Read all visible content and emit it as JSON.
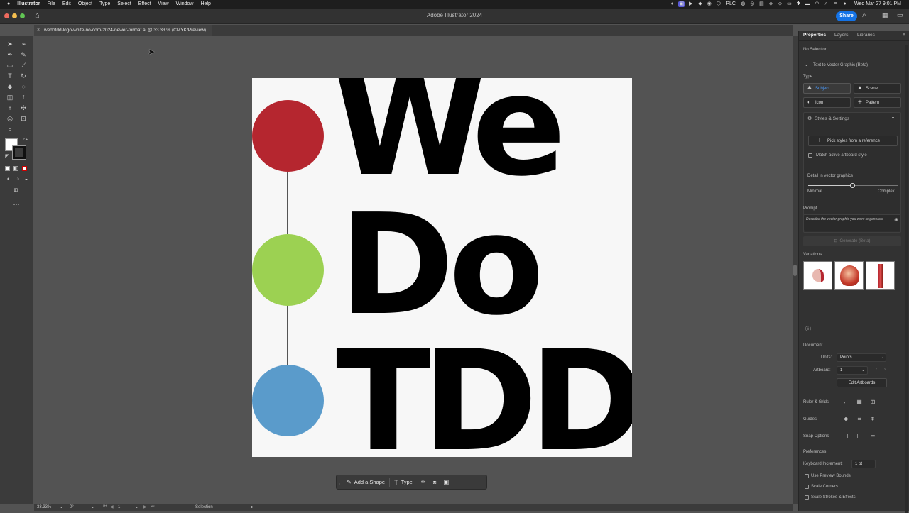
{
  "menubar": {
    "apple": "",
    "app": "Illustrator",
    "items": [
      "File",
      "Edit",
      "Object",
      "Type",
      "Select",
      "Effect",
      "View",
      "Window",
      "Help"
    ],
    "status_text": "PLC",
    "datetime": "Wed Mar 27  9:01 PM"
  },
  "window": {
    "title": "Adobe Illustrator 2024",
    "share_label": "Share"
  },
  "document": {
    "tab_title": "wedotdd-logo-white-no-com-2024-newer-format.ai @ 33.33 % (CMYK/Preview)"
  },
  "artboard": {
    "line1": "We",
    "line2": "Do",
    "line3": "TDD",
    "dot_colors": [
      "#b5262f",
      "#9cd152",
      "#5a9bcb"
    ]
  },
  "context_bar": {
    "add_shape": "Add a Shape",
    "type": "Type"
  },
  "statusbar": {
    "zoom": "33.33%",
    "rotation": "0°",
    "artboard_num": "1",
    "tool": "Selection"
  },
  "panel": {
    "tabs": [
      "Properties",
      "Layers",
      "Libraries"
    ],
    "selection": "No Selection",
    "text_to_vector": "Text to Vector Graphic (Beta)",
    "type_label": "Type",
    "type_options": [
      "Subject",
      "Scene",
      "Icon",
      "Pattern"
    ],
    "styles_settings": "Styles & Settings",
    "pick_styles": "Pick styles from a reference",
    "match_artboard": "Match active artboard style",
    "detail_label": "Detail in vector graphics",
    "detail_min": "Minimal",
    "detail_max": "Complex",
    "detail_level": 0.5,
    "prompt_label": "Prompt",
    "prompt_placeholder": "Describe the vector graphic you want to generate",
    "generate": "Generate (Beta)",
    "variations_label": "Variations",
    "document_label": "Document",
    "units_label": "Units:",
    "units_value": "Points",
    "artboard_label": "Artboard:",
    "artboard_value": "1",
    "edit_artboards": "Edit Artboards",
    "ruler_grids": "Ruler & Grids",
    "guides": "Guides",
    "snap_options": "Snap Options",
    "preferences": "Preferences",
    "keyboard_increment_label": "Keyboard Increment:",
    "keyboard_increment_value": "1 pt",
    "use_preview_bounds": "Use Preview Bounds",
    "scale_corners": "Scale Corners",
    "scale_strokes": "Scale Strokes & Effects"
  }
}
